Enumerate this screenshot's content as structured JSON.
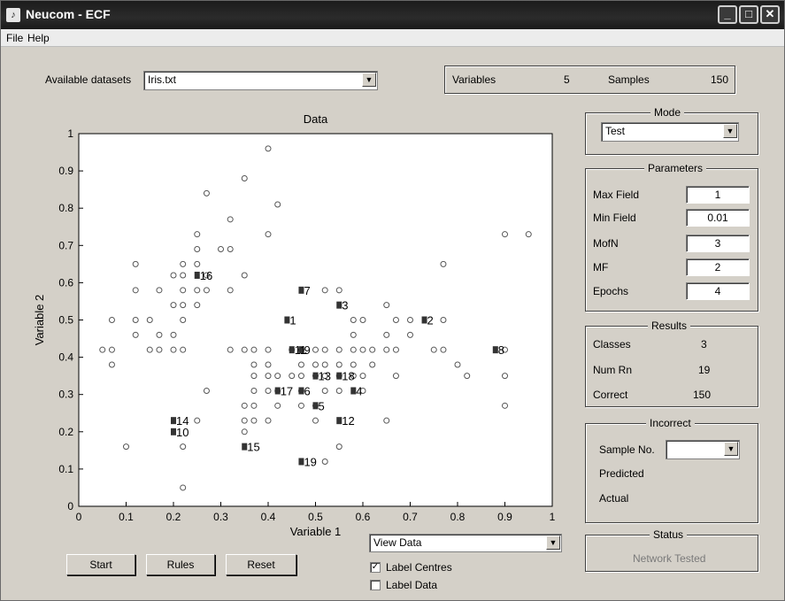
{
  "window": {
    "title": "Neucom - ECF",
    "controls": {
      "minimize": "_",
      "maximize": "□",
      "close": "✕"
    }
  },
  "menu": {
    "items": [
      "File",
      "Help"
    ]
  },
  "datasets": {
    "label": "Available datasets",
    "selected": "Iris.txt"
  },
  "info": {
    "variables_label": "Variables",
    "variables_value": "5",
    "samples_label": "Samples",
    "samples_value": "150"
  },
  "mode": {
    "title": "Mode",
    "selected": "Test"
  },
  "parameters": {
    "title": "Parameters",
    "items": [
      {
        "label": "Max Field",
        "value": "1"
      },
      {
        "label": "Min Field",
        "value": "0.01"
      },
      {
        "label": "MofN",
        "value": "3"
      },
      {
        "label": "MF",
        "value": "2"
      },
      {
        "label": "Epochs",
        "value": "4"
      }
    ]
  },
  "results": {
    "title": "Results",
    "items": [
      {
        "label": "Classes",
        "value": "3"
      },
      {
        "label": "Num Rn",
        "value": "19"
      },
      {
        "label": "Correct",
        "value": "150"
      }
    ]
  },
  "incorrect": {
    "title": "Incorrect",
    "sample_label": "Sample No.",
    "sample_value": "",
    "predicted_label": "Predicted",
    "actual_label": "Actual"
  },
  "status": {
    "title": "Status",
    "text": "Network Tested"
  },
  "buttons": {
    "start": "Start",
    "rules": "Rules",
    "reset": "Reset"
  },
  "view": {
    "selected": "View Data"
  },
  "checkboxes": [
    {
      "label": "Label Centres",
      "checked": true
    },
    {
      "label": "Label Data",
      "checked": false
    }
  ],
  "chart_data": {
    "type": "scatter",
    "title": "Data",
    "xlabel": "Variable 1",
    "ylabel": "Variable 2",
    "xlim": [
      0,
      1
    ],
    "ylim": [
      0,
      1
    ],
    "x_ticks": [
      "0",
      "0.1",
      "0.2",
      "0.3",
      "0.4",
      "0.5",
      "0.6",
      "0.7",
      "0.8",
      "0.9",
      "1"
    ],
    "y_ticks": [
      "0",
      "0.1",
      "0.2",
      "0.3",
      "0.4",
      "0.5",
      "0.6",
      "0.7",
      "0.8",
      "0.9",
      "1"
    ],
    "grid": false,
    "colors": {
      "points": "#555555",
      "centres": "#333333",
      "plot_bg": "#ffffff"
    },
    "data_points": [
      [
        0.05,
        0.42
      ],
      [
        0.07,
        0.42
      ],
      [
        0.07,
        0.5
      ],
      [
        0.07,
        0.38
      ],
      [
        0.1,
        0.16
      ],
      [
        0.12,
        0.65
      ],
      [
        0.12,
        0.58
      ],
      [
        0.12,
        0.5
      ],
      [
        0.12,
        0.46
      ],
      [
        0.15,
        0.5
      ],
      [
        0.15,
        0.42
      ],
      [
        0.17,
        0.58
      ],
      [
        0.17,
        0.46
      ],
      [
        0.17,
        0.42
      ],
      [
        0.2,
        0.46
      ],
      [
        0.2,
        0.42
      ],
      [
        0.2,
        0.54
      ],
      [
        0.2,
        0.62
      ],
      [
        0.22,
        0.65
      ],
      [
        0.22,
        0.58
      ],
      [
        0.22,
        0.62
      ],
      [
        0.22,
        0.54
      ],
      [
        0.22,
        0.5
      ],
      [
        0.22,
        0.42
      ],
      [
        0.22,
        0.16
      ],
      [
        0.22,
        0.05
      ],
      [
        0.25,
        0.73
      ],
      [
        0.25,
        0.69
      ],
      [
        0.25,
        0.65
      ],
      [
        0.25,
        0.58
      ],
      [
        0.25,
        0.54
      ],
      [
        0.25,
        0.23
      ],
      [
        0.27,
        0.84
      ],
      [
        0.27,
        0.62
      ],
      [
        0.27,
        0.58
      ],
      [
        0.27,
        0.31
      ],
      [
        0.3,
        0.69
      ],
      [
        0.32,
        0.77
      ],
      [
        0.32,
        0.69
      ],
      [
        0.32,
        0.58
      ],
      [
        0.32,
        0.42
      ],
      [
        0.35,
        0.88
      ],
      [
        0.35,
        0.62
      ],
      [
        0.35,
        0.42
      ],
      [
        0.35,
        0.27
      ],
      [
        0.35,
        0.23
      ],
      [
        0.35,
        0.2
      ],
      [
        0.37,
        0.42
      ],
      [
        0.37,
        0.38
      ],
      [
        0.37,
        0.35
      ],
      [
        0.37,
        0.31
      ],
      [
        0.37,
        0.27
      ],
      [
        0.37,
        0.23
      ],
      [
        0.4,
        0.96
      ],
      [
        0.4,
        0.73
      ],
      [
        0.4,
        0.42
      ],
      [
        0.4,
        0.38
      ],
      [
        0.4,
        0.35
      ],
      [
        0.4,
        0.31
      ],
      [
        0.4,
        0.23
      ],
      [
        0.42,
        0.81
      ],
      [
        0.42,
        0.35
      ],
      [
        0.42,
        0.31
      ],
      [
        0.42,
        0.27
      ],
      [
        0.45,
        0.42
      ],
      [
        0.45,
        0.35
      ],
      [
        0.47,
        0.42
      ],
      [
        0.47,
        0.38
      ],
      [
        0.47,
        0.35
      ],
      [
        0.47,
        0.31
      ],
      [
        0.47,
        0.27
      ],
      [
        0.5,
        0.42
      ],
      [
        0.5,
        0.38
      ],
      [
        0.5,
        0.35
      ],
      [
        0.5,
        0.27
      ],
      [
        0.5,
        0.23
      ],
      [
        0.52,
        0.58
      ],
      [
        0.52,
        0.42
      ],
      [
        0.52,
        0.38
      ],
      [
        0.52,
        0.35
      ],
      [
        0.52,
        0.31
      ],
      [
        0.52,
        0.12
      ],
      [
        0.55,
        0.58
      ],
      [
        0.55,
        0.42
      ],
      [
        0.55,
        0.38
      ],
      [
        0.55,
        0.35
      ],
      [
        0.55,
        0.31
      ],
      [
        0.55,
        0.16
      ],
      [
        0.58,
        0.5
      ],
      [
        0.58,
        0.46
      ],
      [
        0.58,
        0.42
      ],
      [
        0.58,
        0.38
      ],
      [
        0.58,
        0.35
      ],
      [
        0.6,
        0.5
      ],
      [
        0.6,
        0.42
      ],
      [
        0.6,
        0.35
      ],
      [
        0.6,
        0.31
      ],
      [
        0.62,
        0.42
      ],
      [
        0.62,
        0.38
      ],
      [
        0.65,
        0.54
      ],
      [
        0.65,
        0.46
      ],
      [
        0.65,
        0.42
      ],
      [
        0.65,
        0.23
      ],
      [
        0.67,
        0.5
      ],
      [
        0.67,
        0.42
      ],
      [
        0.67,
        0.35
      ],
      [
        0.7,
        0.5
      ],
      [
        0.7,
        0.46
      ],
      [
        0.75,
        0.42
      ],
      [
        0.77,
        0.65
      ],
      [
        0.77,
        0.5
      ],
      [
        0.77,
        0.42
      ],
      [
        0.8,
        0.38
      ],
      [
        0.82,
        0.35
      ],
      [
        0.9,
        0.73
      ],
      [
        0.9,
        0.42
      ],
      [
        0.9,
        0.35
      ],
      [
        0.9,
        0.27
      ],
      [
        0.95,
        0.73
      ]
    ],
    "centres": [
      {
        "label": "1",
        "x": 0.44,
        "y": 0.5
      },
      {
        "label": "2",
        "x": 0.73,
        "y": 0.5
      },
      {
        "label": "3",
        "x": 0.55,
        "y": 0.54
      },
      {
        "label": "4",
        "x": 0.58,
        "y": 0.31
      },
      {
        "label": "5",
        "x": 0.5,
        "y": 0.27
      },
      {
        "label": "6",
        "x": 0.47,
        "y": 0.31
      },
      {
        "label": "7",
        "x": 0.47,
        "y": 0.58
      },
      {
        "label": "8",
        "x": 0.88,
        "y": 0.42
      },
      {
        "label": "9",
        "x": 0.47,
        "y": 0.42
      },
      {
        "label": "10",
        "x": 0.2,
        "y": 0.2
      },
      {
        "label": "11",
        "x": 0.45,
        "y": 0.42
      },
      {
        "label": "12",
        "x": 0.55,
        "y": 0.23
      },
      {
        "label": "13",
        "x": 0.5,
        "y": 0.35
      },
      {
        "label": "14",
        "x": 0.2,
        "y": 0.23
      },
      {
        "label": "15",
        "x": 0.35,
        "y": 0.16
      },
      {
        "label": "16",
        "x": 0.25,
        "y": 0.62
      },
      {
        "label": "17",
        "x": 0.42,
        "y": 0.31
      },
      {
        "label": "18",
        "x": 0.55,
        "y": 0.35
      },
      {
        "label": "19",
        "x": 0.47,
        "y": 0.12
      }
    ]
  }
}
